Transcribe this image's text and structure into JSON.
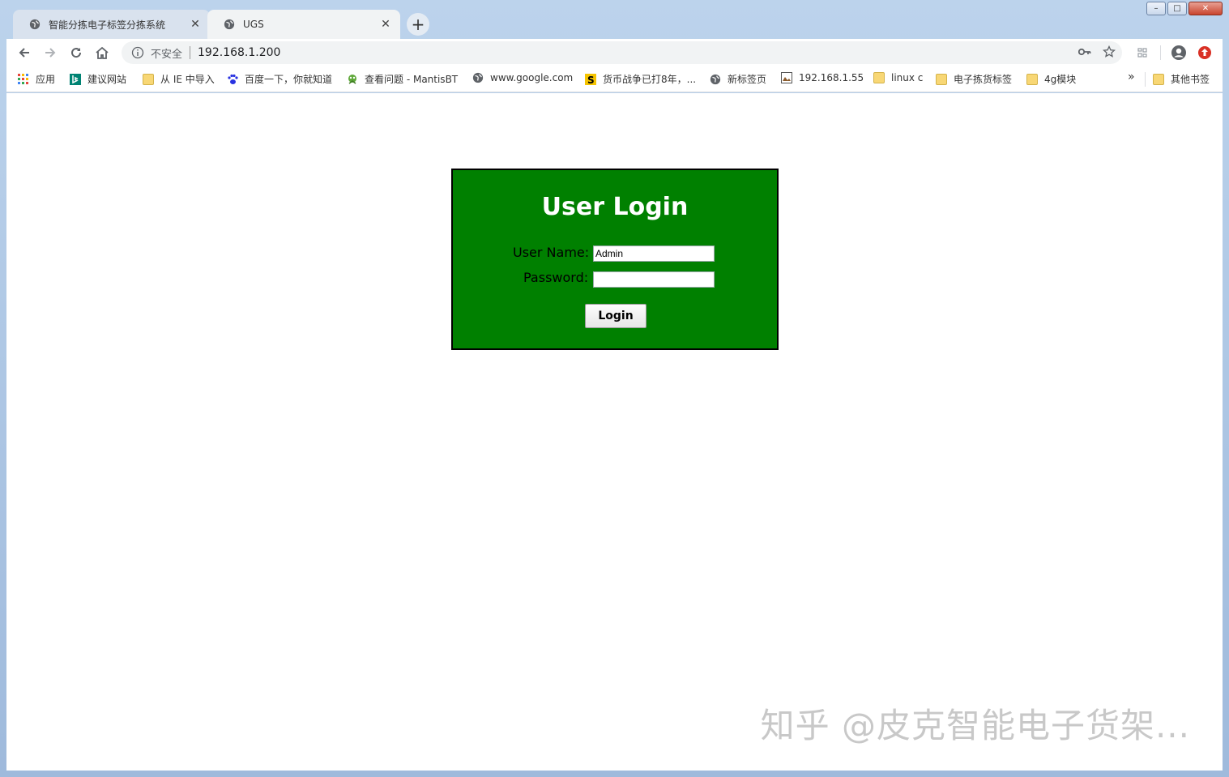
{
  "browser": {
    "tabs": [
      {
        "title": "智能分拣电子标签分拣系统",
        "active": false
      },
      {
        "title": "UGS",
        "active": true
      }
    ],
    "security_label": "不安全",
    "url": "192.168.1.200",
    "bookmarks": [
      {
        "label": "应用",
        "icon": "apps-grid-icon"
      },
      {
        "label": "建议网站",
        "icon": "bing-icon"
      },
      {
        "label": "从 IE 中导入",
        "icon": "folder-icon"
      },
      {
        "label": "百度一下，你就知道",
        "icon": "baidu-paw-icon"
      },
      {
        "label": "查看问题 - MantisBT",
        "icon": "mantis-icon"
      },
      {
        "label": "www.google.com",
        "icon": "globe-icon"
      },
      {
        "label": "货币战争已打8年，...",
        "icon": "s-logo-icon"
      },
      {
        "label": "新标签页",
        "icon": "globe-icon"
      },
      {
        "label": "192.168.1.55",
        "icon": "image-icon"
      },
      {
        "label": "linux c",
        "icon": "folder-icon"
      },
      {
        "label": "电子拣货标签",
        "icon": "folder-icon"
      },
      {
        "label": "4g模块",
        "icon": "folder-icon"
      }
    ],
    "overflow_label": "»",
    "other_bookmarks": "其他书签"
  },
  "login": {
    "title": "User Login",
    "username_label": "User Name:",
    "username_value": "Admin",
    "password_label": "Password:",
    "password_value": "",
    "button_label": "Login",
    "panel_color": "#008000"
  },
  "watermark": "知乎 @皮克智能电子货架..."
}
